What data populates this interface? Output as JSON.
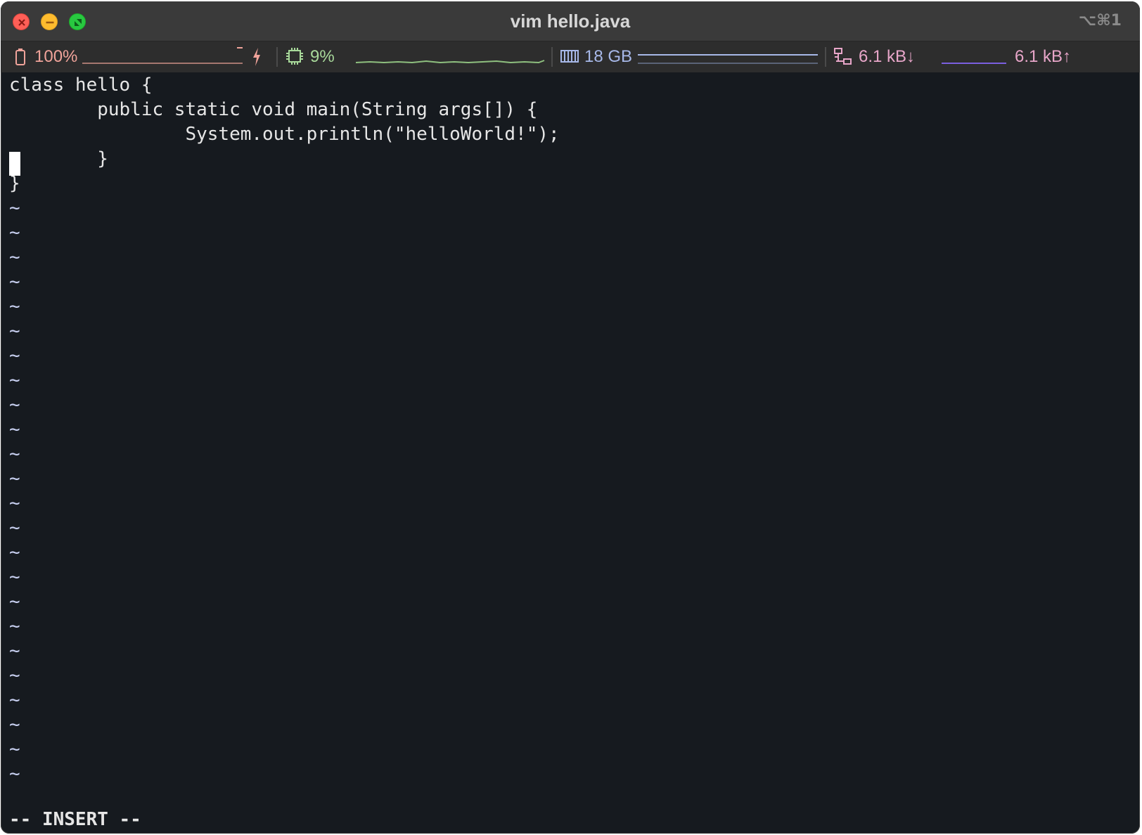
{
  "window": {
    "title": "vim hello.java",
    "shortcut": "⌥⌘1"
  },
  "status": {
    "battery": {
      "icon": "battery-icon",
      "value": "100%",
      "charging_icon": "lightning-bolt-icon"
    },
    "cpu": {
      "icon": "cpu-icon",
      "value": "9%"
    },
    "memory": {
      "icon": "memory-icon",
      "value": "18 GB"
    },
    "network": {
      "icon": "network-icon",
      "down": "6.1 kB↓",
      "up": "6.1 kB↑"
    },
    "colors": {
      "battery": "#f0a39a",
      "cpu": "#a8d99a",
      "memory": "#a7b8e8",
      "network": "#e8a6c9"
    }
  },
  "editor": {
    "lines": [
      "class hello {",
      "        public static void main(String args[]) {",
      "                System.out.println(\"helloWorld!\");",
      "        }",
      "}"
    ],
    "empty_line_marker": "~",
    "mode": "-- INSERT --"
  }
}
